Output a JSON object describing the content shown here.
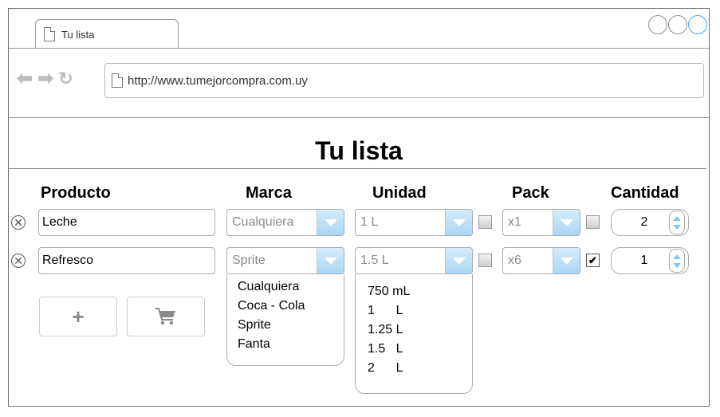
{
  "browser": {
    "tab_title": "Tu lista",
    "url": "http://www.tumejorcompra.com.uy"
  },
  "page": {
    "title": "Tu lista"
  },
  "columns": {
    "producto": "Producto",
    "marca": "Marca",
    "unidad": "Unidad",
    "pack": "Pack",
    "cantidad": "Cantidad"
  },
  "rows": [
    {
      "producto": "Leche",
      "marca": "Cualquiera",
      "unidad": "1 L",
      "pack": "x1",
      "pack_checked": false,
      "unidad_checked": false,
      "cantidad": "2"
    },
    {
      "producto": "Refresco",
      "marca": "Sprite",
      "unidad": "1.5 L",
      "pack": "x6",
      "pack_checked": true,
      "unidad_checked": false,
      "cantidad": "1"
    }
  ],
  "marca_options": [
    "Cualquiera",
    "Coca - Cola",
    "Sprite",
    "Fanta"
  ],
  "unidad_options": [
    "750 mL",
    "1      L",
    "1.25 L",
    "1.5   L",
    "2      L"
  ],
  "colors": {
    "accent": "#4aa3df",
    "select_button": "#a9d6f5",
    "border": "#aaaaaa"
  },
  "icons": {
    "add": "plus-icon",
    "cart": "cart-icon",
    "remove": "remove-circle-icon"
  }
}
